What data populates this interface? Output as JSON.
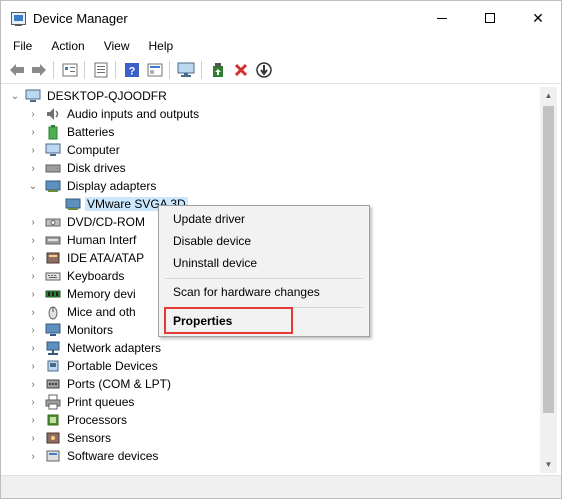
{
  "window": {
    "title": "Device Manager",
    "controls": {
      "minimize": "minimize",
      "maximize": "maximize",
      "close": "✕"
    }
  },
  "menubar": [
    "File",
    "Action",
    "View",
    "Help"
  ],
  "toolbar": {
    "icons": [
      "back-arrow-icon",
      "forward-arrow-icon",
      "device-view-icon",
      "properties-sheet-icon",
      "help-icon",
      "show-hidden-icon",
      "monitor-icon",
      "update-driver-icon",
      "uninstall-icon",
      "download-icon"
    ]
  },
  "tree": {
    "root": "DESKTOP-QJOODFR",
    "items": [
      {
        "label": "Audio inputs and outputs",
        "icon": "speaker-icon",
        "expanded": false
      },
      {
        "label": "Batteries",
        "icon": "battery-icon",
        "expanded": false
      },
      {
        "label": "Computer",
        "icon": "computer-icon",
        "expanded": false
      },
      {
        "label": "Disk drives",
        "icon": "disk-icon",
        "expanded": false
      },
      {
        "label": "Display adapters",
        "icon": "display-adapter-icon",
        "expanded": true
      },
      {
        "label": "VMware SVGA 3D",
        "icon": "display-adapter-icon",
        "child": true,
        "selected": true
      },
      {
        "label": "DVD/CD-ROM",
        "icon": "dvd-icon",
        "expanded": false
      },
      {
        "label": "Human Interf",
        "icon": "hid-icon",
        "expanded": false
      },
      {
        "label": "IDE ATA/ATAP",
        "icon": "ide-icon",
        "expanded": false
      },
      {
        "label": "Keyboards",
        "icon": "keyboard-icon",
        "expanded": false
      },
      {
        "label": "Memory devi",
        "icon": "memory-icon",
        "expanded": false
      },
      {
        "label": "Mice and oth",
        "icon": "mouse-icon",
        "expanded": false
      },
      {
        "label": "Monitors",
        "icon": "monitor-icon",
        "expanded": false
      },
      {
        "label": "Network adapters",
        "icon": "network-icon",
        "expanded": false
      },
      {
        "label": "Portable Devices",
        "icon": "portable-icon",
        "expanded": false
      },
      {
        "label": "Ports (COM & LPT)",
        "icon": "port-icon",
        "expanded": false
      },
      {
        "label": "Print queues",
        "icon": "printer-icon",
        "expanded": false
      },
      {
        "label": "Processors",
        "icon": "processor-icon",
        "expanded": false
      },
      {
        "label": "Sensors",
        "icon": "sensor-icon",
        "expanded": false
      },
      {
        "label": "Software devices",
        "icon": "software-icon",
        "expanded": false
      }
    ]
  },
  "context_menu": {
    "update": "Update driver",
    "disable": "Disable device",
    "uninstall": "Uninstall device",
    "scan": "Scan for hardware changes",
    "properties": "Properties"
  },
  "colors": {
    "selection": "#cce8ff",
    "highlight": "#e53935",
    "menu_bg": "#f2f2f2"
  }
}
